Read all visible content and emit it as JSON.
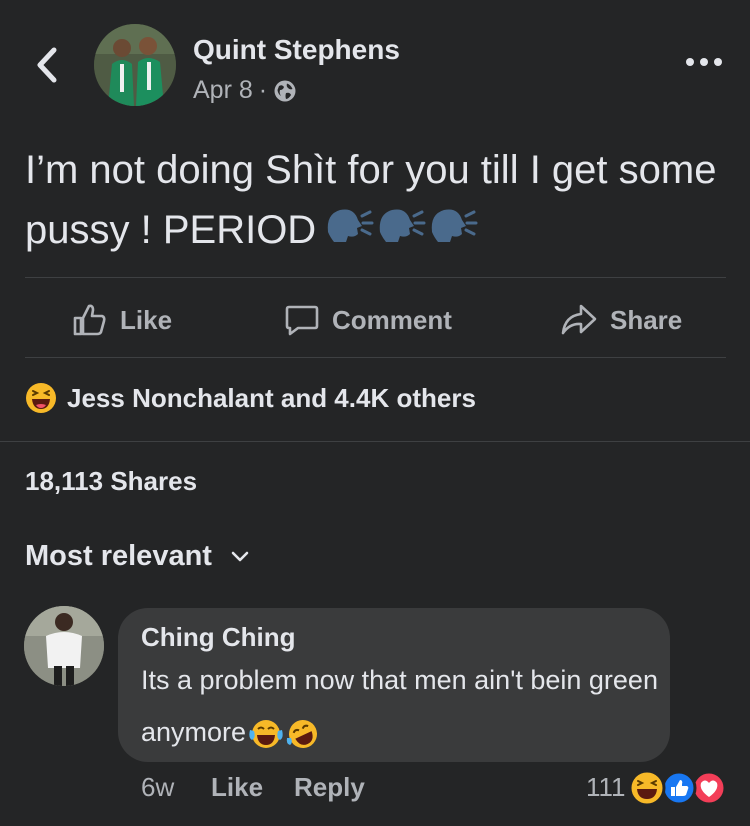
{
  "post": {
    "author": "Quint Stephens",
    "date": "Apr 8",
    "separator": "·",
    "text": "I’m not doing Shìt for you till I get some pussy ! PERIOD",
    "emoji_icons": [
      "speaking-head-icon",
      "speaking-head-icon",
      "speaking-head-icon"
    ]
  },
  "actions": {
    "like": "Like",
    "comment": "Comment",
    "share": "Share"
  },
  "reactions_summary": "Jess Nonchalant and 4.4K others",
  "shares_count": "18,113 Shares",
  "sort": {
    "label": "Most relevant"
  },
  "comment": {
    "author": "Ching Ching",
    "text": "Its a problem now that men ain't bein green anymore",
    "emoji_icons": [
      "face-with-tears-of-joy-icon",
      "rolling-on-floor-laughing-icon"
    ],
    "time": "6w",
    "like_label": "Like",
    "reply_label": "Reply",
    "reaction_count": "111"
  },
  "colors": {
    "background": "#242526",
    "bubble": "#3a3b3c",
    "primary_text": "#e4e6eb",
    "secondary_text": "#b0b3b8",
    "like_blue": "#1877f2",
    "love_red": "#f33e58",
    "haha_yellow": "#f7b928"
  }
}
